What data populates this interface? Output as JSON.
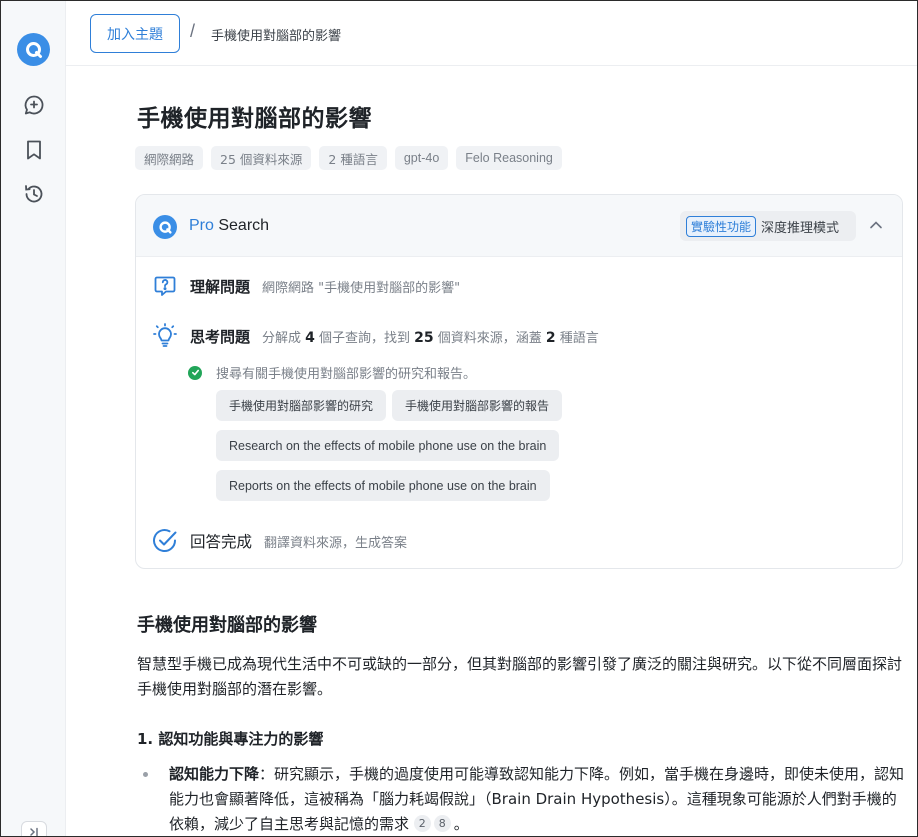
{
  "header": {
    "add_topic_label": "加入主題",
    "breadcrumb_sep": "/",
    "breadcrumb_title": "手機使用對腦部的影響"
  },
  "page": {
    "title": "手機使用對腦部的影響",
    "tags": [
      "網際網路",
      "25 個資料來源",
      "2 種語言",
      "gpt-4o",
      "Felo Reasoning"
    ]
  },
  "pro_search": {
    "pro": "Pro",
    "search": " Search",
    "experimental_badge": "實驗性功能",
    "mode_label": "深度推理模式",
    "steps": [
      {
        "title": "理解問題",
        "desc": "網際網路 \"手機使用對腦部的影響\""
      },
      {
        "title": "思考問題",
        "desc_parts": [
          "分解成 ",
          "4",
          " 個子查詢，找到 ",
          "25",
          " 個資料來源，涵蓋 ",
          "2",
          " 種語言"
        ]
      },
      {
        "title": "回答完成",
        "desc": "翻譯資料來源，生成答案"
      }
    ],
    "sub_step": "搜尋有關手機使用對腦部影響的研究和報告。",
    "queries": [
      "手機使用對腦部影響的研究",
      "手機使用對腦部影響的報告",
      "Research on the effects of mobile phone use on the brain",
      "Reports on the effects of mobile phone use on the brain"
    ]
  },
  "answer": {
    "heading": "手機使用對腦部的影響",
    "intro": "智慧型手機已成為現代生活中不可或缺的一部分，但其對腦部的影響引發了廣泛的關注與研究。以下從不同層面探討手機使用對腦部的潛在影響。",
    "section1_heading": "1. 認知功能與專注力的影響",
    "bullet1_keyword": "認知能力下降",
    "bullet1_text": "：研究顯示，手機的過度使用可能導致認知能力下降。例如，當手機在身邊時，即使未使用，認知能力也會顯著降低，這被稱為「腦力耗竭假說」（Brain Drain Hypothesis）。這種現象可能源於人們對手機的依賴，減少了自主思考與記憶的需求",
    "bullet1_citations": [
      "2",
      "8"
    ],
    "bullet1_end": "。"
  },
  "colors": {
    "accent": "#2f7fd8",
    "check_green": "#22a559",
    "sidebar_bg": "#f6f8fa"
  },
  "icons": {
    "sidebar": [
      "felo-logo-icon",
      "new-chat-icon",
      "bookmark-icon",
      "history-icon",
      "collapse-sidebar-icon"
    ],
    "steps": [
      "question-bubble-icon",
      "lightbulb-icon",
      "check-circle-icon"
    ]
  }
}
